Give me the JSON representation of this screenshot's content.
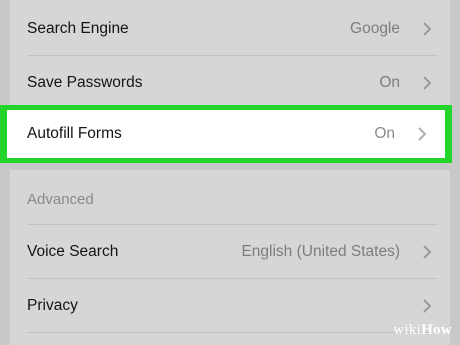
{
  "settings": {
    "rows_top": [
      {
        "label": "Search Engine",
        "value": "Google"
      },
      {
        "label": "Save Passwords",
        "value": "On"
      }
    ],
    "highlighted": {
      "label": "Autofill Forms",
      "value": "On"
    },
    "section_title": "Advanced",
    "rows_bottom": [
      {
        "label": "Voice Search",
        "value": "English (United States)"
      },
      {
        "label": "Privacy",
        "value": ""
      }
    ]
  },
  "icons": {
    "chevron": "chevron-right-icon"
  },
  "colors": {
    "highlight_border": "#23d42a",
    "background": "#c8c8c8"
  },
  "watermark": {
    "part1": "wiki",
    "part2": "How"
  }
}
